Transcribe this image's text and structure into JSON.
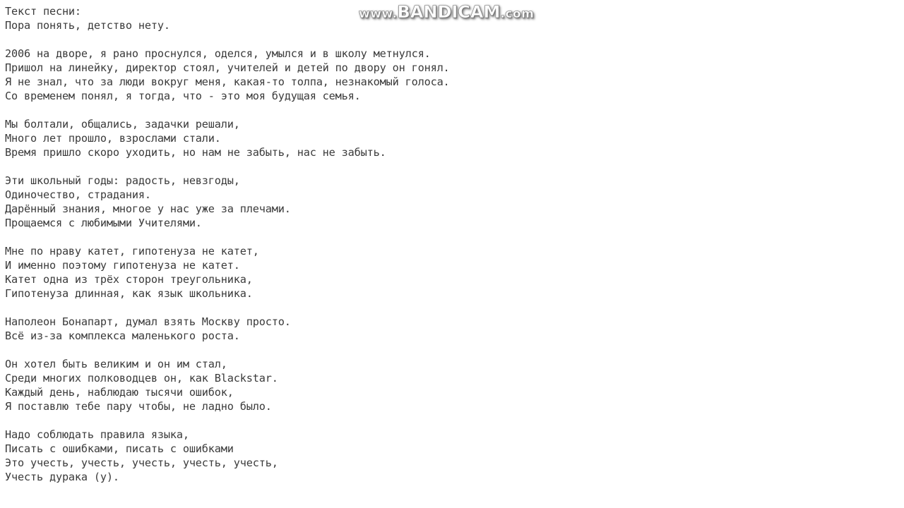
{
  "page": {
    "background_color": "#ffffff",
    "text_color": "#3a3a3a"
  },
  "watermark": {
    "name": "bandicam-watermark",
    "prefix": "www.",
    "brand": "BANDICAM",
    "suffix": ".com",
    "full_text": "www.BANDICAM.com",
    "color": "#ffffff",
    "outline_color": "#8d8d8d"
  },
  "lyrics": {
    "heading": "Текст песни:",
    "stanzas": [
      {
        "id": "stanza-1",
        "lines": [
          "Текст песни:",
          "Пора понять, детство нету."
        ]
      },
      {
        "id": "stanza-2",
        "lines": [
          "2006 на дворе, я рано проснулся, оделся, умылся и в школу метнулся.",
          "Пришол на линейку, директор стоял, учителей и детей по двору он гонял.",
          "Я не знал, что за люди вокруг меня, какая-то толпа, незнакомый голоса.",
          "Со временем понял, я тогда, что - это моя будущая семья."
        ]
      },
      {
        "id": "stanza-3",
        "lines": [
          "Мы болтали, общались, задачки решали,",
          "Много лет прошло, взрослами стали.",
          "Время пришло скоро уходить, но нам не забыть, нас не забыть."
        ]
      },
      {
        "id": "stanza-4",
        "lines": [
          "Эти школьный годы: радость, невзгоды,",
          "Одиночество, страдания.",
          "Дарённый знания, многое у нас уже за плечами.",
          "Прощаемся с любимыми Учителями."
        ]
      },
      {
        "id": "stanza-5",
        "lines": [
          "Мне по нраву катет, гипотенуза не катет,",
          "И именно поэтому гипотенуза не катет.",
          "Катет одна из трёх сторон треугольника,",
          "Гипотенуза длинная, как язык школьника."
        ]
      },
      {
        "id": "stanza-6",
        "lines": [
          "Наполеон Бонапарт, думал взять Москву просто.",
          "Всё из-за комплекса маленького роста."
        ]
      },
      {
        "id": "stanza-7",
        "lines": [
          "Он хотел быть великим и он им стал,",
          "Среди многих полководцев он, как Blackstar.",
          "Каждый день, наблюдаю тысячи ошибок,",
          "Я поставлю тебе пару чтобы, не ладно было."
        ]
      },
      {
        "id": "stanza-8",
        "lines": [
          "Надо соблюдать правила языка,",
          "Писать с ошибками, писать с ошибками",
          "Это учесть, учесть, учесть, учесть, учесть,",
          "Учесть дурака (у)."
        ]
      }
    ]
  }
}
